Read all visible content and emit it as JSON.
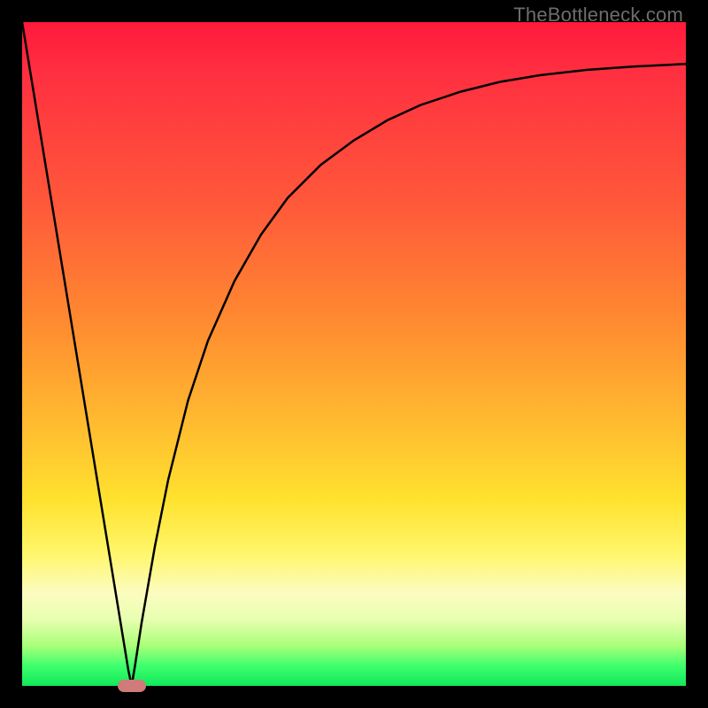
{
  "watermark": "TheBottleneck.com",
  "chart_data": {
    "type": "line",
    "x": [
      0.0,
      0.02,
      0.04,
      0.06,
      0.08,
      0.1,
      0.12,
      0.14,
      0.16,
      0.165,
      0.17,
      0.18,
      0.2,
      0.22,
      0.25,
      0.28,
      0.32,
      0.36,
      0.4,
      0.45,
      0.5,
      0.55,
      0.6,
      0.66,
      0.72,
      0.78,
      0.85,
      0.92,
      1.0
    ],
    "values": [
      1.0,
      0.878,
      0.756,
      0.634,
      0.512,
      0.39,
      0.268,
      0.146,
      0.024,
      0.0,
      0.03,
      0.095,
      0.21,
      0.31,
      0.43,
      0.52,
      0.61,
      0.68,
      0.735,
      0.785,
      0.822,
      0.852,
      0.875,
      0.895,
      0.91,
      0.92,
      0.928,
      0.933,
      0.937
    ],
    "xlim": [
      0,
      1
    ],
    "ylim": [
      0,
      1
    ],
    "title": "",
    "xlabel": "",
    "ylabel": "",
    "notch_x": 0.165,
    "marker": {
      "x": 0.165,
      "y": 0.0,
      "color": "#d07a7a"
    }
  },
  "colors": {
    "curve": "#000000",
    "marker": "#d07a7a"
  }
}
